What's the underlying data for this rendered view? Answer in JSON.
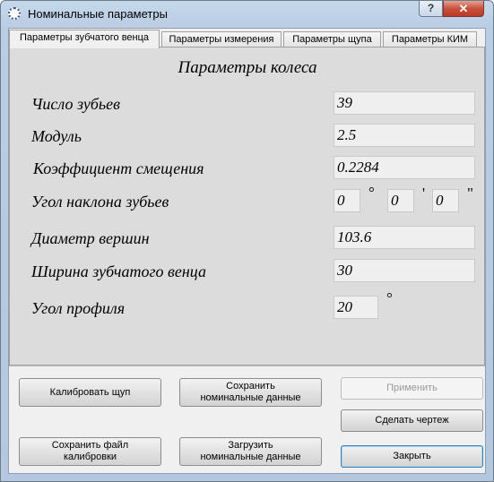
{
  "window": {
    "title": "Номинальные параметры",
    "help_glyph": "?",
    "close_glyph": "✕"
  },
  "tabs": [
    {
      "label": "Параметры зубчатого венца",
      "active": true
    },
    {
      "label": "Параметры измерения",
      "active": false
    },
    {
      "label": "Параметры щупа",
      "active": false
    },
    {
      "label": "Параметры КИМ",
      "active": false
    }
  ],
  "panel": {
    "heading": "Параметры колеса",
    "teeth_count": {
      "label": "Число зубьев",
      "value": "39"
    },
    "module": {
      "label": "Модуль",
      "value": "2.5"
    },
    "shift_coef": {
      "label": "Коэффициент смещения",
      "value": "0.2284"
    },
    "helix_angle": {
      "label": "Угол наклона зубьев",
      "deg": "0",
      "min": "0",
      "sec": "0",
      "deg_unit": "°",
      "min_unit": "'",
      "sec_unit": "\""
    },
    "tip_diameter": {
      "label": "Диаметр вершин",
      "value": "103.6"
    },
    "face_width": {
      "label": "Ширина зубчатого венца",
      "value": "30"
    },
    "pressure_angle": {
      "label": "Угол профиля",
      "value": "20",
      "unit": "°"
    }
  },
  "buttons": {
    "calibrate_probe": "Калибровать щуп",
    "save_nominal": "Сохранить номинальные данные",
    "apply": "Применить",
    "make_drawing": "Сделать чертеж",
    "save_calibration": "Сохранить файл калибровки",
    "load_nominal": "Загрузить номинальные данные",
    "close": "Закрыть"
  },
  "colors": {
    "title_bar": "#b9cde3",
    "close_button": "#c8513c",
    "panel_bg": "#dcdcdc",
    "field_bg": "#efefef"
  }
}
